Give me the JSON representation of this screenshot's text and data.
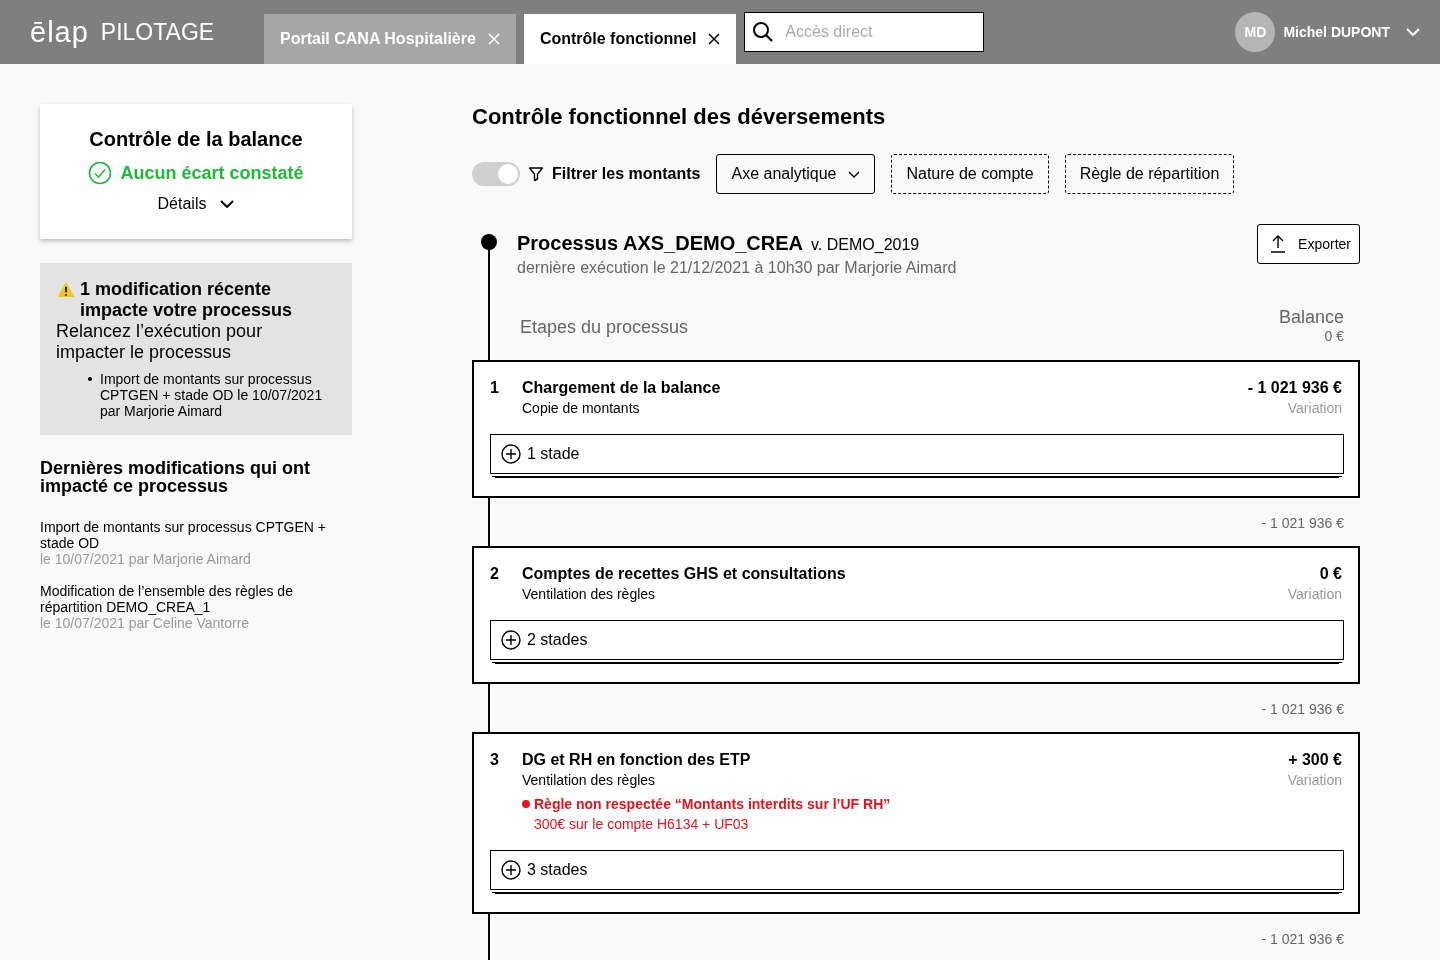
{
  "header": {
    "logo": "ēlap",
    "product": "PILOTAGE",
    "tabs": [
      {
        "label": "Portail CANA Hospitalière",
        "selected": false
      },
      {
        "label": "Contrôle fonctionnel",
        "selected": true
      }
    ],
    "search": {
      "placeholder": "Accès direct"
    },
    "user": {
      "initials": "MD",
      "name": "Michel DUPONT"
    }
  },
  "balance_check": {
    "title": "Contrôle de la balance",
    "status": "Aucun écart constaté",
    "details": "Détails"
  },
  "warning": {
    "title": "1 modification récente impacte votre processus",
    "text": "Relancez l’exécution pour impacter le processus",
    "items": [
      "Import de montants sur processus CPTGEN + stade OD le 10/07/2021 par Marjorie Aimard"
    ]
  },
  "recent": {
    "title": "Dernières modifications qui ont impacté ce processus",
    "items": [
      {
        "text": "Import de montants sur processus CPTGEN + stade OD",
        "meta": "le 10/07/2021 par Marjorie Aimard"
      },
      {
        "text": "Modification de l’ensemble des règles de répartition DEMO_CREA_1",
        "meta": "le 10/07/2021 par Celine Vantorre"
      }
    ]
  },
  "page_title": "Contrôle fonctionnel des déversements",
  "filters": {
    "toggle_on": true,
    "label": "Filtrer les montants",
    "items": [
      {
        "label": "Axe analytique",
        "kind": "dropdown"
      },
      {
        "label": "Nature de compte",
        "kind": "slot"
      },
      {
        "label": "Règle de répartition",
        "kind": "slot"
      }
    ]
  },
  "process": {
    "name": "Processus AXS_DEMO_CREA",
    "version": "v. DEMO_2019",
    "last_run": "dernière exécution le 21/12/2021 à 10h30 par Marjorie Aimard",
    "export": "Exporter",
    "steps_label": "Etapes du processus",
    "balance_label": "Balance",
    "balance": "0 €"
  },
  "steps": [
    {
      "number": "1",
      "title": "Chargement de la balance",
      "subtitle": "Copie de montants",
      "amount": "- 1 021 936 €",
      "amount_label": "Variation",
      "stades": "1 stade",
      "balance_after": "- 1 021 936 €"
    },
    {
      "number": "2",
      "title": "Comptes de recettes GHS et consultations",
      "subtitle": "Ventilation des règles",
      "amount": "0 €",
      "amount_label": "Variation",
      "stades": "2 stades",
      "balance_after": "- 1 021 936 €"
    },
    {
      "number": "3",
      "title": "DG et RH en fonction des ETP",
      "subtitle": "Ventilation des règles",
      "amount": "+ 300 €",
      "amount_label": "Variation",
      "alert": {
        "title": "Règle non respectée “Montants interdits sur l’UF RH”",
        "detail": "300€ sur le compte H6134 + UF03"
      },
      "stades": "3 stades",
      "balance_after": "- 1 021 936 €"
    }
  ]
}
